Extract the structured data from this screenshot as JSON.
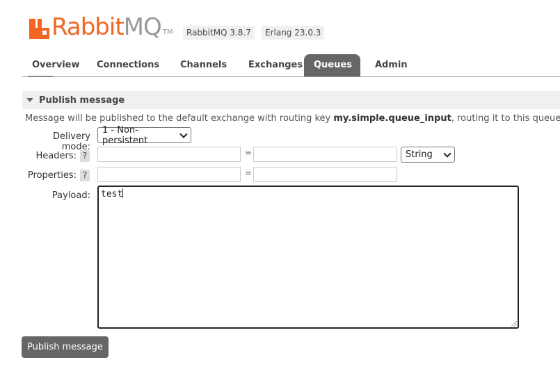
{
  "header": {
    "logo": {
      "brand": "Rabbit",
      "suffix": "MQ",
      "tm": "TM"
    },
    "version_rabbitmq": "RabbitMQ 3.8.7",
    "version_erlang": "Erlang 23.0.3"
  },
  "tabs": [
    {
      "label": "Overview",
      "active": false
    },
    {
      "label": "Connections",
      "active": false
    },
    {
      "label": "Channels",
      "active": false
    },
    {
      "label": "Exchanges",
      "active": false
    },
    {
      "label": "Queues",
      "active": true
    },
    {
      "label": "Admin",
      "active": false
    }
  ],
  "publish": {
    "section_title": "Publish message",
    "description_prefix": "Message will be published to the default exchange with routing key ",
    "routing_key": "my.simple.queue_input",
    "description_suffix": ", routing it to this queue.",
    "delivery_mode_label": "Delivery mode:",
    "delivery_mode_value": "1 - Non-persistent",
    "headers_label": "Headers:",
    "headers_key": "",
    "headers_value": "",
    "headers_type": "String",
    "properties_label": "Properties:",
    "properties_key": "",
    "properties_value": "",
    "payload_label": "Payload:",
    "payload_value": "test",
    "help_glyph": "?",
    "equals": "=",
    "button_label": "Publish message"
  },
  "colors": {
    "brand_orange": "#f26522",
    "active_tab": "#666666",
    "button": "#666666"
  },
  "icons": {
    "section_toggle": "triangle-down-icon",
    "select_arrow": "chevron-down-icon"
  }
}
